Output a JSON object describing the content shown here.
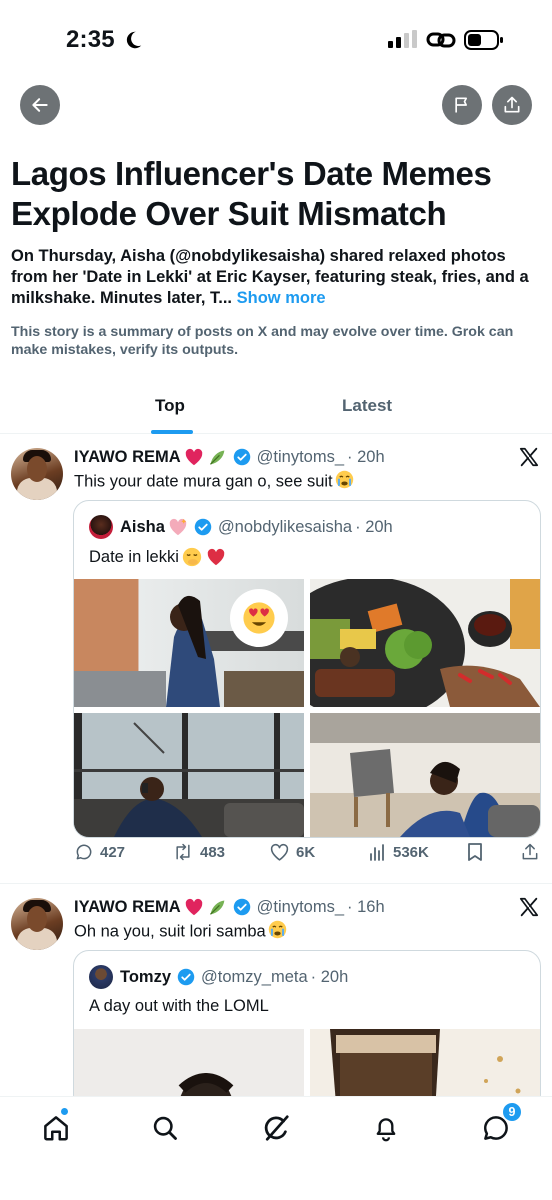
{
  "status_bar": {
    "time": "2:35"
  },
  "header": {
    "headline": "Lagos Influencer's Date Memes Explode Over Suit Mismatch",
    "summary": "On Thursday, Aisha (@nobdylikesaisha) shared relaxed photos from her 'Date in Lekki' at Eric Kayser, featuring steak, fries, and a milkshake. Minutes later, T...",
    "show_more": "Show more",
    "disclaimer": "This story is a summary of posts on X and may evolve over time. Grok can make mistakes, verify its outputs."
  },
  "tabs": [
    {
      "label": "Top",
      "active": true
    },
    {
      "label": "Latest",
      "active": false
    }
  ],
  "posts": [
    {
      "name": "IYAWO REMA",
      "handle": "@tinytoms_",
      "time": "· 20h",
      "text": "This your date mura gan o, see suit",
      "quote": {
        "name": "Aisha",
        "handle": "@nobdylikesaisha",
        "time": "· 20h",
        "text": "Date in lekki"
      },
      "stats": {
        "replies": "427",
        "reposts": "483",
        "likes": "6K",
        "views": "536K"
      }
    },
    {
      "name": "IYAWO REMA",
      "handle": "@tinytoms_",
      "time": "· 16h",
      "text": "Oh na you, suit lori samba",
      "quote": {
        "name": "Tomzy",
        "handle": "@tomzy_meta",
        "time": "· 20h",
        "text": "A day out with the LOML"
      }
    }
  ],
  "bottom_nav": {
    "messages_badge": "9"
  },
  "colors": {
    "accent": "#1d9bf0",
    "text": "#0f1419",
    "muted": "#536471",
    "like": "#f91880"
  }
}
